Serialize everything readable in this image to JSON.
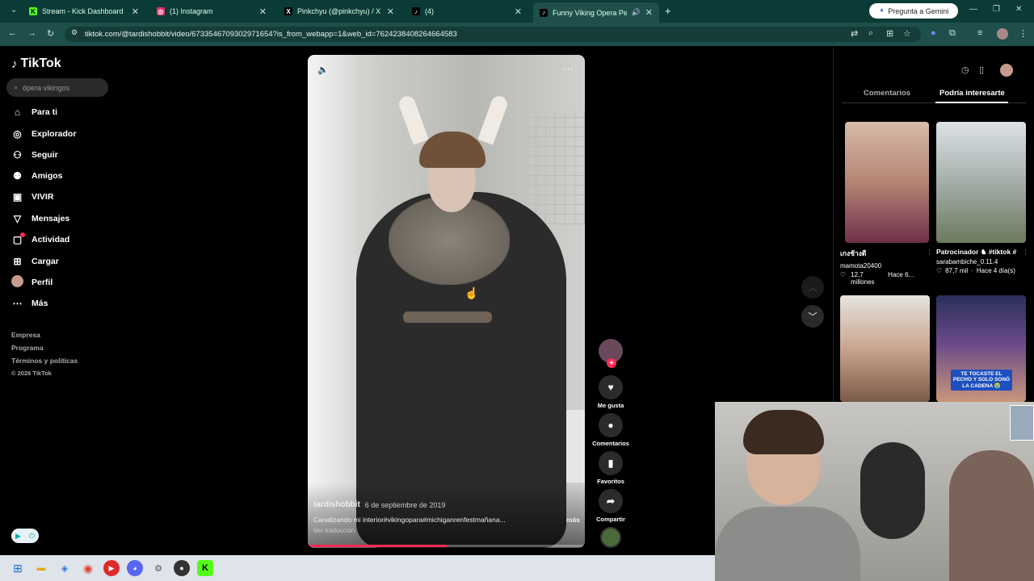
{
  "browser": {
    "tabs": [
      {
        "label": "Stream - Kick Dashboard",
        "icon": "kick-icon",
        "color": "#53fc18"
      },
      {
        "label": "(1) Instagram",
        "icon": "instagram-icon",
        "color": "#e1306c"
      },
      {
        "label": "Pinkchyu (@pinkchyu) / X",
        "icon": "x-icon",
        "color": "#000000"
      },
      {
        "label": "(4)",
        "icon": "tiktok-icon",
        "color": "#000000"
      },
      {
        "label": "Funny Viking Opera Perfor",
        "icon": "tiktok-icon",
        "color": "#000000"
      }
    ],
    "gemini_label": "Pregunta a Gemini",
    "url": "tiktok.com/@tardishobbit/video/6733546709302971654?is_from_webapp=1&web_id=7624238408264664583"
  },
  "sidebar": {
    "logo": "TikTok",
    "search_placeholder": "ópera vikingos",
    "nav": [
      {
        "label": "Para ti",
        "icon": "home-icon"
      },
      {
        "label": "Explorador",
        "icon": "compass-icon"
      },
      {
        "label": "Seguir",
        "icon": "user-follow-icon"
      },
      {
        "label": "Amigos",
        "icon": "friends-icon"
      },
      {
        "label": "VIVIR",
        "icon": "live-icon"
      },
      {
        "label": "Mensajes",
        "icon": "messages-icon"
      },
      {
        "label": "Actividad",
        "icon": "activity-icon"
      },
      {
        "label": "Cargar",
        "icon": "upload-icon"
      },
      {
        "label": "Perfil",
        "icon": "avatar"
      },
      {
        "label": "Más",
        "icon": "more-icon"
      }
    ],
    "footer": [
      "Empresa",
      "Programa",
      "Términos y políticas",
      "© 2026 TikTok"
    ]
  },
  "video": {
    "author": "tardishobbit",
    "date": "6 de septiembre de 2019",
    "caption": "Canalizando mi interior#vikingopara#michiganrenfestmañana...",
    "more": "más",
    "translate": "Ver traducción",
    "progress": 0.5
  },
  "actions": {
    "like": "Me gusta",
    "comments": "Comentarios",
    "favorites": "Favoritos",
    "share": "Compartir"
  },
  "right_panel": {
    "tabs": [
      "Comentarios",
      "Podría interesarte"
    ],
    "active_tab": 1,
    "cards": [
      {
        "title": "เกงช้างดี",
        "user": "mamota20400",
        "views": "12,7 millones",
        "age": "Hace 6..."
      },
      {
        "title": "Patrocinador ♞ #tiktok #",
        "user": "sarabambiche_0.11.4",
        "views": "87,7 mil",
        "age": "Hace 4 día(s)"
      },
      {
        "title": "",
        "user": "",
        "views": "",
        "age": "",
        "overlay": ""
      },
      {
        "title": "",
        "user": "",
        "views": "",
        "age": "",
        "overlay": "TE TOCASTE EL PECHO Y SOLO SONÓ LA CADENA 😭"
      }
    ]
  }
}
